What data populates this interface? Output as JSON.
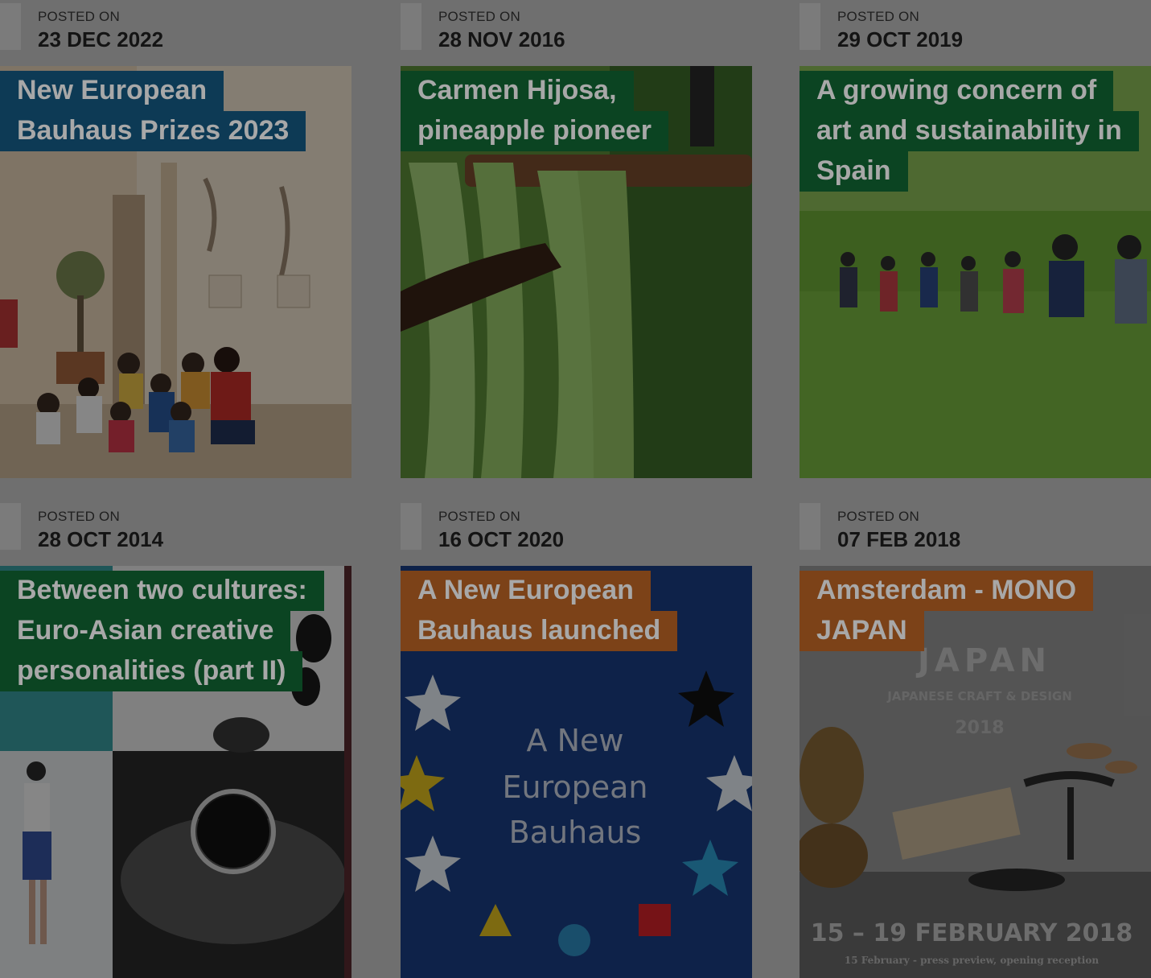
{
  "posts": [
    {
      "posted_label": "POSTED ON",
      "date": "23 DEC 2022",
      "title_lines": [
        "New European",
        "Bauhaus Prizes 2023"
      ],
      "category_color": "#0d3a55"
    },
    {
      "posted_label": "POSTED ON",
      "date": "28 NOV 2016",
      "title_lines": [
        "Carmen Hijosa,",
        "pineapple pioneer"
      ],
      "category_color": "#0b4422"
    },
    {
      "posted_label": "POSTED ON",
      "date": "29 OCT 2019",
      "title_lines": [
        "A growing concern of",
        "art and sustainability in",
        "Spain"
      ],
      "category_color": "#0b4422"
    },
    {
      "posted_label": "POSTED ON",
      "date": "28 OCT 2014",
      "title_lines": [
        "Between two cultures:",
        "Euro-Asian creative",
        "personalities (part II)"
      ],
      "category_color": "#0b4422"
    },
    {
      "posted_label": "POSTED ON",
      "date": "16 OCT 2020",
      "title_lines": [
        "A New European",
        "Bauhaus launched"
      ],
      "category_color": "#7c4218",
      "image_text": [
        "A New",
        "European",
        "Bauhaus"
      ]
    },
    {
      "posted_label": "POSTED ON",
      "date": "07 FEB 2018",
      "title_lines": [
        "Amsterdam - MONO",
        "JAPAN"
      ],
      "category_color": "#7c4218",
      "image_text": [
        "JAPAN",
        "JAPANESE CRAFT & DESIGN",
        "2018",
        "15 – 19 FEBRUARY 2018",
        "15 February - press preview, opening reception"
      ]
    }
  ]
}
